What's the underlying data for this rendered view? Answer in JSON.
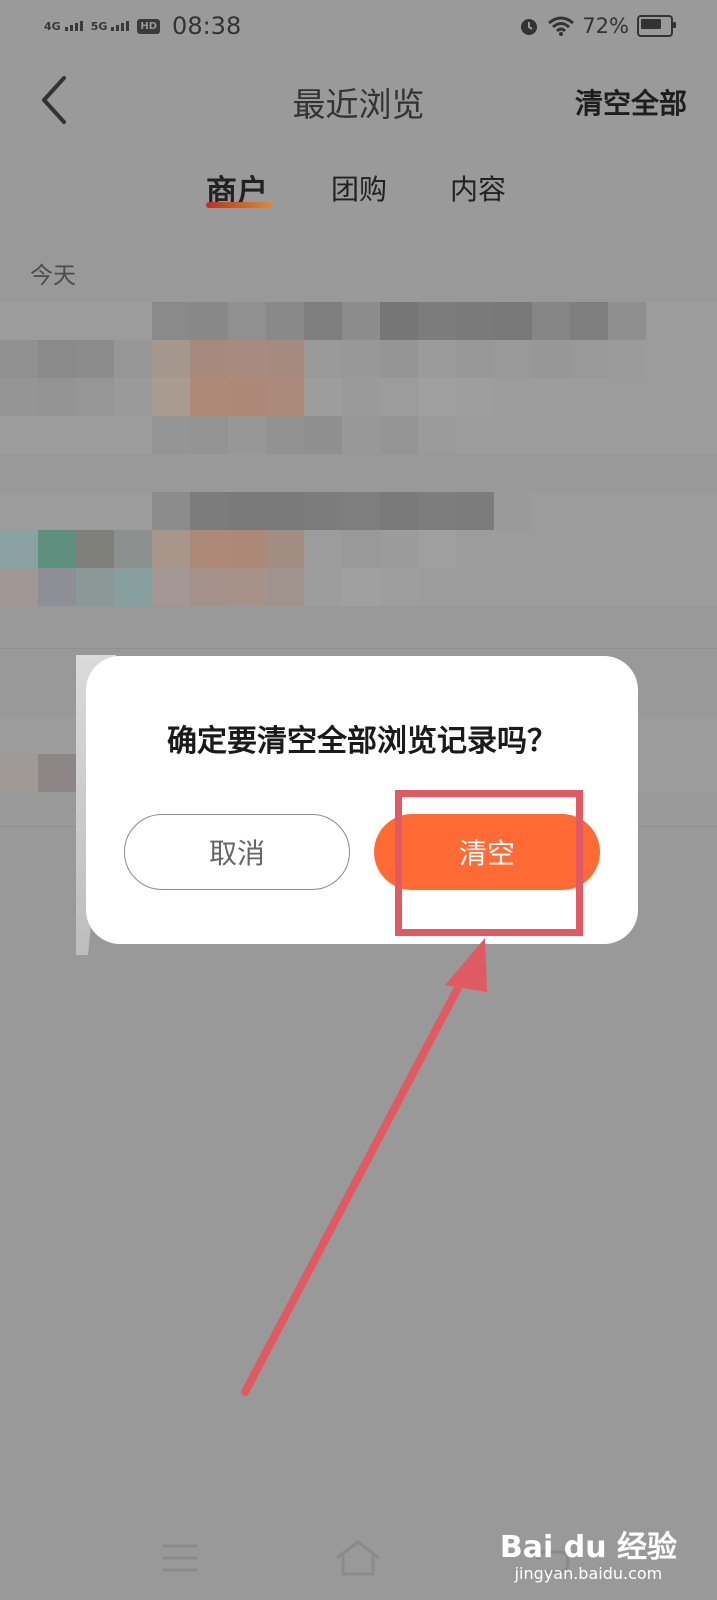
{
  "status_bar": {
    "net1": "4G",
    "net2": "5G",
    "hd": "HD",
    "time": "08:38",
    "battery_pct": "72%",
    "battery_level": 0.72,
    "icons": [
      "alarm-icon",
      "wifi-icon",
      "battery-icon"
    ]
  },
  "header": {
    "title": "最近浏览",
    "clear_all": "清空全部",
    "back_icon": "chevron-left-icon"
  },
  "tabs": [
    {
      "label": "商户",
      "active": true
    },
    {
      "label": "团购",
      "active": false
    },
    {
      "label": "内容",
      "active": false
    }
  ],
  "list": {
    "section_date": "今天"
  },
  "dialog": {
    "message": "确定要清空全部浏览记录吗？",
    "cancel": "取消",
    "confirm": "清空"
  },
  "colors": {
    "overlay": "#999999",
    "accent": "#ff6a35",
    "annotation": "#e05a63",
    "tab_indicator_start": "#b8341e",
    "tab_indicator_end": "#d98a3b"
  },
  "nav_icons": [
    "menu-icon",
    "home-icon",
    "back-icon"
  ],
  "watermark": {
    "logo": "Bai du 经验",
    "sub": "jingyan.baidu.com"
  }
}
